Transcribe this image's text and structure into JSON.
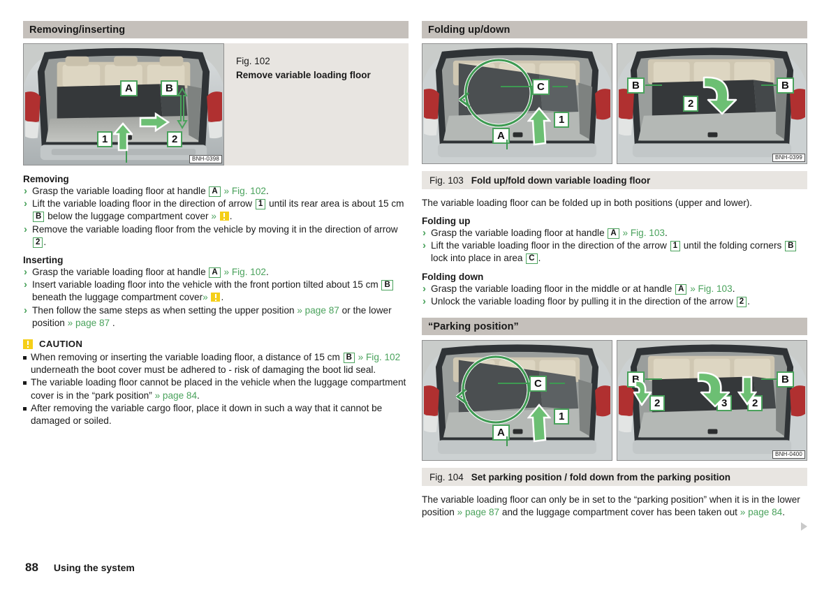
{
  "page": {
    "number": "88",
    "title": "Using the system"
  },
  "left_column": {
    "section_header": "Removing/inserting",
    "figure": {
      "caption_number": "Fig. 102",
      "caption_text": "Remove variable loading floor",
      "image_code": "BNH-0398",
      "callouts": [
        "A",
        "B",
        "1",
        "2"
      ]
    },
    "removing": {
      "heading": "Removing",
      "steps": [
        {
          "parts": [
            {
              "t": "Grasp the variable loading floor at handle ",
              "k": "text"
            },
            {
              "t": "A",
              "k": "ref"
            },
            {
              "t": " ",
              "k": "text"
            },
            {
              "t": "» Fig. 102",
              "k": "link"
            },
            {
              "t": ".",
              "k": "text"
            }
          ]
        },
        {
          "parts": [
            {
              "t": "Lift the variable loading floor in the direction of arrow ",
              "k": "text"
            },
            {
              "t": "1",
              "k": "ref"
            },
            {
              "t": " until its rear area is about 15 cm ",
              "k": "text"
            },
            {
              "t": "B",
              "k": "ref"
            },
            {
              "t": " below the luggage compartment cover ",
              "k": "text"
            },
            {
              "t": "»",
              "k": "link"
            },
            {
              "t": " ",
              "k": "text"
            },
            {
              "t": "",
              "k": "warn"
            },
            {
              "t": ".",
              "k": "text"
            }
          ]
        },
        {
          "parts": [
            {
              "t": "Remove the variable loading floor from the vehicle by moving it in the direction of arrow ",
              "k": "text"
            },
            {
              "t": "2",
              "k": "ref"
            },
            {
              "t": ".",
              "k": "text"
            }
          ]
        }
      ]
    },
    "inserting": {
      "heading": "Inserting",
      "steps": [
        {
          "parts": [
            {
              "t": "Grasp the variable loading floor at handle ",
              "k": "text"
            },
            {
              "t": "A",
              "k": "ref"
            },
            {
              "t": " ",
              "k": "text"
            },
            {
              "t": "» Fig. 102",
              "k": "link"
            },
            {
              "t": ".",
              "k": "text"
            }
          ]
        },
        {
          "parts": [
            {
              "t": "Insert variable loading floor into the vehicle with the front portion tilted about 15 cm ",
              "k": "text"
            },
            {
              "t": "B",
              "k": "ref"
            },
            {
              "t": "beneath the luggage compartment cover",
              "k": "text"
            },
            {
              "t": "»",
              "k": "link"
            },
            {
              "t": " ",
              "k": "text"
            },
            {
              "t": "",
              "k": "warn"
            },
            {
              "t": ".",
              "k": "text"
            }
          ]
        },
        {
          "parts": [
            {
              "t": "Then follow the same steps as when setting the upper position ",
              "k": "text"
            },
            {
              "t": "» page 87",
              "k": "link"
            },
            {
              "t": " or the lower position ",
              "k": "text"
            },
            {
              "t": "» page 87",
              "k": "link"
            },
            {
              "t": " .",
              "k": "text"
            }
          ]
        }
      ]
    },
    "caution": {
      "title": "CAUTION",
      "icon": "warning-icon",
      "items": [
        {
          "parts": [
            {
              "t": "When removing or inserting the variable loading floor, a distance of 15 cm ",
              "k": "text"
            },
            {
              "t": "B",
              "k": "ref"
            },
            {
              "t": " ",
              "k": "text"
            },
            {
              "t": "» Fig. 102",
              "k": "link"
            },
            {
              "t": " underneath the boot cover must be adhered to - risk of damaging the boot lid seal.",
              "k": "text"
            }
          ]
        },
        {
          "parts": [
            {
              "t": "The variable loading floor cannot be placed in the vehicle when the luggage compartment cover is in the “park position” ",
              "k": "text"
            },
            {
              "t": "» page 84",
              "k": "link"
            },
            {
              "t": ".",
              "k": "text"
            }
          ]
        },
        {
          "parts": [
            {
              "t": "After removing the variable cargo floor, place it down in such a way that it cannot be damaged or soiled.",
              "k": "text"
            }
          ]
        }
      ]
    }
  },
  "right_column": {
    "section_header_1": "Folding up/down",
    "figure_103": {
      "caption_number": "Fig. 103",
      "caption_text": "Fold up/fold down variable loading floor",
      "image_code": "BNH-0399",
      "callouts_left": [
        "C",
        "A",
        "1"
      ],
      "callouts_right": [
        "B",
        "B",
        "2"
      ]
    },
    "intro": "The variable loading floor can be folded up in both positions (upper and lower).",
    "folding_up": {
      "heading": "Folding up",
      "steps": [
        {
          "parts": [
            {
              "t": "Grasp the variable loading floor at handle ",
              "k": "text"
            },
            {
              "t": "A",
              "k": "ref"
            },
            {
              "t": " ",
              "k": "text"
            },
            {
              "t": "» Fig. 103",
              "k": "link"
            },
            {
              "t": ".",
              "k": "text"
            }
          ]
        },
        {
          "parts": [
            {
              "t": "Lift the variable loading floor in the direction of the arrow ",
              "k": "text"
            },
            {
              "t": "1",
              "k": "ref"
            },
            {
              "t": " until the folding corners ",
              "k": "text"
            },
            {
              "t": "B",
              "k": "ref"
            },
            {
              "t": " lock into place in area ",
              "k": "text"
            },
            {
              "t": "C",
              "k": "ref"
            },
            {
              "t": ".",
              "k": "text"
            }
          ]
        }
      ]
    },
    "folding_down": {
      "heading": "Folding down",
      "steps": [
        {
          "parts": [
            {
              "t": "Grasp the variable loading floor in the middle or at handle ",
              "k": "text"
            },
            {
              "t": "A",
              "k": "ref"
            },
            {
              "t": " ",
              "k": "text"
            },
            {
              "t": "» Fig. 103",
              "k": "link"
            },
            {
              "t": ".",
              "k": "text"
            }
          ]
        },
        {
          "parts": [
            {
              "t": "Unlock the variable loading floor by pulling it in the direction of the arrow ",
              "k": "text"
            },
            {
              "t": "2",
              "k": "ref"
            },
            {
              "t": ".",
              "k": "text"
            }
          ]
        }
      ]
    },
    "section_header_2": "“Parking position”",
    "figure_104": {
      "caption_number": "Fig. 104",
      "caption_text": "Set parking position / fold down from the parking position",
      "image_code": "BNH-0400",
      "callouts_left": [
        "C",
        "A",
        "1"
      ],
      "callouts_right": [
        "B",
        "B",
        "2",
        "3",
        "2"
      ]
    },
    "outro": {
      "parts": [
        {
          "t": "The variable loading floor can only be in set to the “parking position” when it is in the lower position ",
          "k": "text"
        },
        {
          "t": "» page 87",
          "k": "link"
        },
        {
          "t": " and the luggage compartment cover has been taken out ",
          "k": "text"
        },
        {
          "t": "» page 84",
          "k": "link"
        },
        {
          "t": ".",
          "k": "text"
        }
      ]
    }
  },
  "colors": {
    "section_header_bg": "#c5c0bb",
    "caption_bar_bg": "#e8e5e1",
    "link_green": "#4aa25c",
    "warning_yellow": "#f5cf18",
    "text": "#1a1a1a"
  }
}
